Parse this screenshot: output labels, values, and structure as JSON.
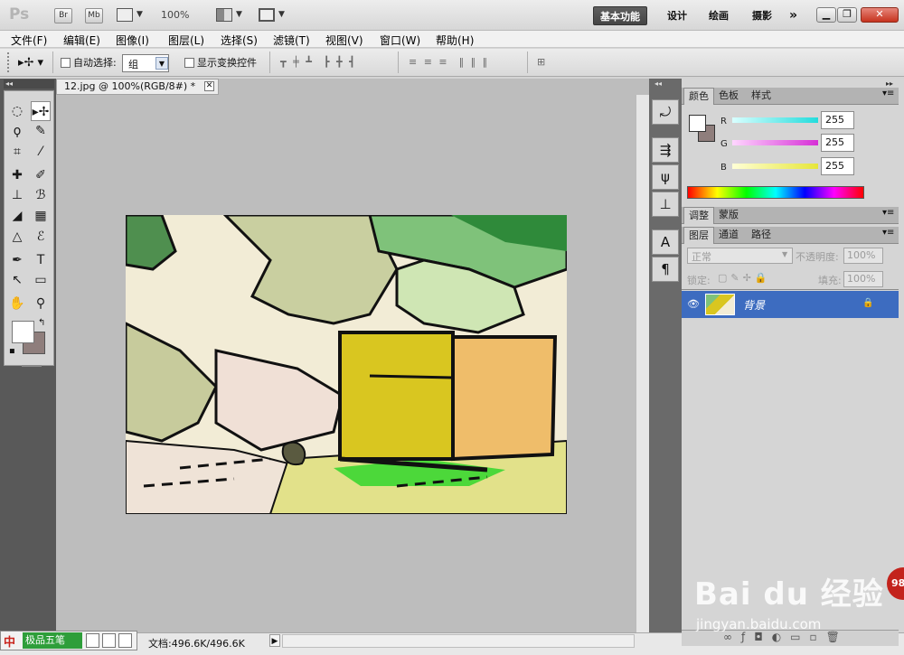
{
  "app": {
    "logo": "Ps",
    "bridge": "Br",
    "minibridge": "Mb",
    "zoom": "100%"
  },
  "workspaces": [
    "基本功能",
    "设计",
    "绘画",
    "摄影",
    "»"
  ],
  "menus": [
    "文件(F)",
    "编辑(E)",
    "图像(I)",
    "图层(L)",
    "选择(S)",
    "滤镜(T)",
    "视图(V)",
    "窗口(W)",
    "帮助(H)"
  ],
  "options": {
    "auto_select_label": "自动选择:",
    "auto_select_value": "组",
    "show_transform_label": "显示变换控件"
  },
  "document": {
    "tab_title": "12.jpg @ 100%(RGB/8#) *",
    "status": "文档:496.6K/496.6K"
  },
  "ime": {
    "label": "极品五笔"
  },
  "color_panel": {
    "tabs": [
      "颜色",
      "色板",
      "样式"
    ],
    "channels": [
      {
        "label": "R",
        "value": "255",
        "color": "#35e0e0"
      },
      {
        "label": "G",
        "value": "255",
        "color": "#d62fd6"
      },
      {
        "label": "B",
        "value": "255",
        "color": "#e6e63a"
      }
    ]
  },
  "adjust_panel": {
    "tabs": [
      "调整",
      "蒙版"
    ]
  },
  "layers_panel": {
    "tabs": [
      "图层",
      "通道",
      "路径"
    ],
    "blend_mode": "正常",
    "opacity_label": "不透明度:",
    "opacity_value": "100%",
    "lock_label": "锁定:",
    "fill_label": "填充:",
    "fill_value": "100%",
    "layers": [
      {
        "name": "背景",
        "locked": true,
        "visible": true
      }
    ]
  },
  "watermark": {
    "text": "Bai du 经验",
    "url": "jingyan.baidu.com",
    "badge": "98"
  },
  "colors": {
    "accent": "#3d6cc0",
    "close": "#c7331e"
  }
}
